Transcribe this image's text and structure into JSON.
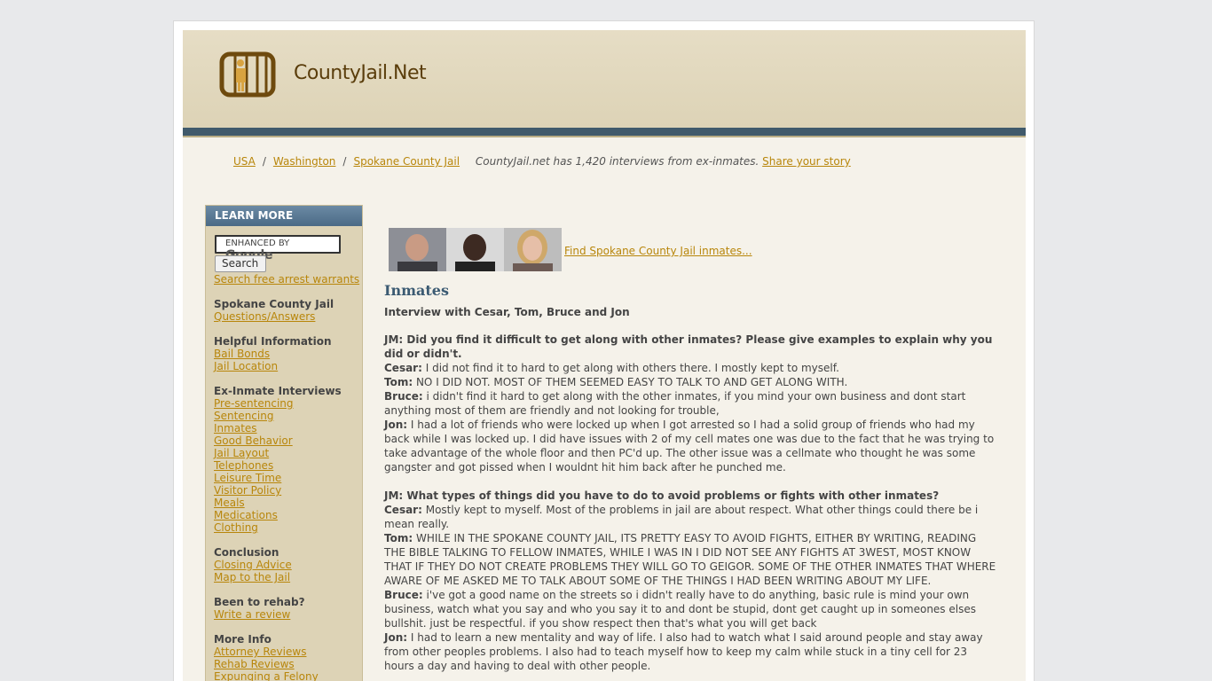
{
  "header": {
    "site_name": "CountyJail.Net",
    "colors": {
      "brand": "#8a5a14",
      "accent": "#b8860b",
      "bar": "#405a6b"
    },
    "logo": "jail-bars-icon"
  },
  "breadcrumb": {
    "items": [
      "USA",
      "Washington",
      "Spokane County Jail"
    ],
    "note": "CountyJail.net has 1,420 interviews from ex-inmates.",
    "note_link": "Share your story"
  },
  "sidebar": {
    "heading": "LEARN MORE",
    "search": {
      "brand_prefix": "ENHANCED BY",
      "brand": "Google",
      "button": "Search"
    },
    "free_warrants": "Search free arrest warrants",
    "groups": [
      {
        "title": "Spokane County Jail",
        "links": [
          "Questions/Answers"
        ]
      },
      {
        "title": "Helpful Information",
        "links": [
          "Bail Bonds",
          "Jail Location"
        ]
      },
      {
        "title": "Ex-Inmate Interviews",
        "links": [
          "Pre-sentencing",
          "Sentencing",
          "Inmates",
          "Good Behavior",
          "Jail Layout",
          "Telephones",
          "Leisure Time",
          "Visitor Policy",
          "Meals",
          "Medications",
          "Clothing"
        ]
      },
      {
        "title": "Conclusion",
        "links": [
          "Closing Advice",
          "Map to the Jail"
        ]
      },
      {
        "title": "Been to rehab?",
        "links": [
          "Write a review"
        ]
      },
      {
        "title": "More Info",
        "links": [
          "Attorney Reviews",
          "Rehab Reviews",
          "Expunging a Felony"
        ]
      }
    ]
  },
  "content": {
    "find_link": "Find Spokane County Jail inmates...",
    "title": "Inmates",
    "subtitle": "Interview with Cesar, Tom, Bruce and Jon",
    "qa": [
      {
        "question": "JM: Did you find it difficult to get along with other inmates? Please give examples to explain why you did or didn't.",
        "answers": [
          {
            "who": "Cesar:",
            "text": " I did not find it to hard to get along with others there. I mostly kept to myself."
          },
          {
            "who": "Tom:",
            "text": " NO I DID NOT. MOST OF THEM SEEMED EASY TO TALK TO AND GET ALONG WITH."
          },
          {
            "who": "Bruce:",
            "text": " i didn't find it hard to get along with the other inmates, if you mind your own business and dont start anything most of them are friendly and not looking for trouble,"
          },
          {
            "who": "Jon:",
            "text": " I had a lot of friends who were locked up when I got arrested so I had a solid group of friends who had my back while I was locked up. I did have issues with 2 of my cell mates one was due to the fact that he was trying to take advantage of the whole floor and then PC'd up. The other issue was a cellmate who thought he was some gangster and got pissed when I wouldnt hit him back after he punched me."
          }
        ]
      },
      {
        "question": "JM: What types of things did you have to do to avoid problems or fights with other inmates?",
        "answers": [
          {
            "who": "Cesar:",
            "text": " Mostly kept to myself. Most of the problems in jail are about respect. What other things could there be i mean really."
          },
          {
            "who": "Tom:",
            "text": " WHILE IN THE SPOKANE COUNTY JAIL, ITS PRETTY EASY TO AVOID FIGHTS, EITHER BY WRITING, READING THE BIBLE TALKING TO FELLOW INMATES, WHILE I WAS IN I DID NOT SEE ANY FIGHTS AT 3WEST, MOST KNOW THAT IF THEY DO NOT CREATE PROBLEMS THEY WILL GO TO GEIGOR. SOME OF THE OTHER INMATES THAT WHERE AWARE OF ME ASKED ME TO TALK ABOUT SOME OF THE THINGS I HAD BEEN WRITING ABOUT MY LIFE."
          },
          {
            "who": "Bruce:",
            "text": " i've got a good name on the streets so i didn't really have to do anything, basic rule is mind your own business, watch what you say and who you say it to and dont be stupid, dont get caught up in someones elses bullshit. just be respectful. if you show respect then that's what you will get back"
          },
          {
            "who": "Jon:",
            "text": " I had to learn a new mentality and way of life. I also had to watch what I said around people and stay away from other peoples problems. I also had to teach myself how to keep my calm while stuck in a tiny cell for 23 hours a day and having to deal with other people."
          }
        ]
      }
    ]
  }
}
